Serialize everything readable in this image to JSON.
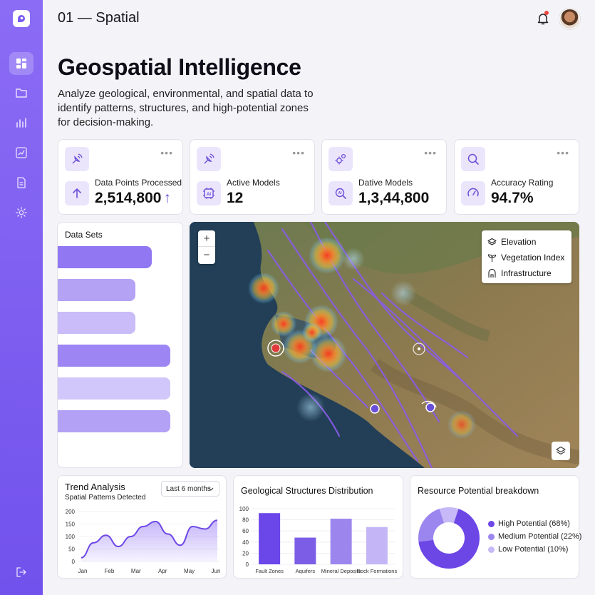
{
  "header": {
    "title": "01 — Spatial"
  },
  "page": {
    "title": "Geospatial Intelligence",
    "description": "Analyze geological, environmental, and spatial data to identify patterns, structures, and high-potential zones for decision-making."
  },
  "sidebar": {
    "items": [
      {
        "icon": "grid-icon"
      },
      {
        "icon": "folder-icon"
      },
      {
        "icon": "bar-chart-icon"
      },
      {
        "icon": "trend-chart-icon"
      },
      {
        "icon": "document-icon"
      },
      {
        "icon": "gear-icon"
      }
    ],
    "logout_icon": "logout-icon"
  },
  "stats": [
    {
      "label": "Data Points Processed",
      "value": "2,514,800",
      "trend": "↑"
    },
    {
      "label": "Active Models",
      "value": "12"
    },
    {
      "label": "Dative Models",
      "value": "1,3,44,800"
    },
    {
      "label": "Accuracy Rating",
      "value": "94.7%"
    }
  ],
  "stat_menu": "•••",
  "datasets": {
    "title": "Data Sets",
    "bars": [
      {
        "fraction": 0.75,
        "color": "#9178f2"
      },
      {
        "fraction": 0.62,
        "color": "#b4a2f5"
      },
      {
        "fraction": 0.62,
        "color": "#c9bcf8"
      },
      {
        "fraction": 0.9,
        "color": "#9d86f3"
      },
      {
        "fraction": 0.9,
        "color": "#d2c7fa"
      },
      {
        "fraction": 0.9,
        "color": "#b3a1f5"
      }
    ]
  },
  "map": {
    "zoom_in": "+",
    "zoom_out": "−",
    "layers": [
      "Elevation",
      "Vegetation Index",
      "Infrastructure"
    ]
  },
  "trend": {
    "title": "Trend Analysis",
    "subtitle": "Spatial Patterns Detected",
    "range": "Last 6 months",
    "chart_data": {
      "type": "area",
      "x": [
        "Jan",
        "Feb",
        "Mar",
        "Apr",
        "May",
        "Jun"
      ],
      "yticks": [
        "200",
        "150",
        "100",
        "50",
        "0"
      ],
      "ylim": [
        0,
        200
      ],
      "values": [
        15,
        75,
        105,
        60,
        100,
        140,
        160,
        110,
        65,
        140,
        130,
        165
      ]
    }
  },
  "geo": {
    "title": "Geological Structures Distribution",
    "chart_data": {
      "type": "bar",
      "categories": [
        "Fault Zones",
        "Aquifers",
        "Mineral Deposits",
        "Rock Formations"
      ],
      "values": [
        92,
        48,
        82,
        67
      ],
      "ylim": [
        0,
        100
      ],
      "yticks": [
        "100",
        "80",
        "60",
        "40",
        "20",
        "0"
      ],
      "colors": [
        "#6b46e8",
        "#7c5de6",
        "#9c86ee",
        "#c4b6f6"
      ]
    }
  },
  "resource": {
    "title": "Resource Potential breakdown",
    "chart_data": {
      "type": "pie",
      "labels": [
        "High Potential (68%)",
        "Medium Potential (22%)",
        "Low Potential (10%)"
      ],
      "values": [
        68,
        22,
        10
      ],
      "colors": [
        "#6d47e6",
        "#9b85ee",
        "#c6b9f7"
      ]
    }
  }
}
